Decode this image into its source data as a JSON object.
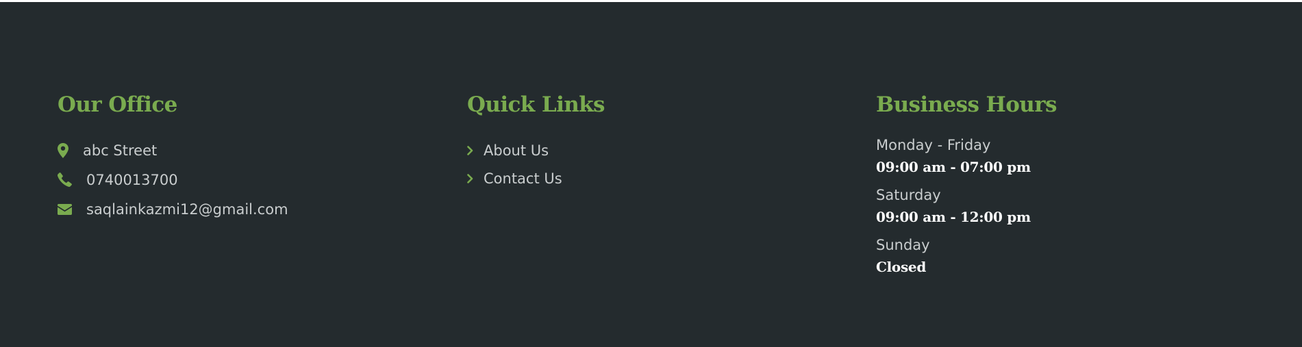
{
  "colors": {
    "background": "#242b2e",
    "accent": "#7aab4f",
    "text": "#c9cdce",
    "strong_text": "#ffffff"
  },
  "office": {
    "title": "Our Office",
    "address": {
      "icon": "map-marker-icon",
      "text": "abc Street"
    },
    "phone": {
      "icon": "phone-icon",
      "text": "0740013700"
    },
    "email": {
      "icon": "envelope-icon",
      "text": "saqlainkazmi12@gmail.com"
    }
  },
  "quick_links": {
    "title": "Quick Links",
    "icon": "chevron-right-icon",
    "items": [
      {
        "label": "About Us"
      },
      {
        "label": "Contact Us"
      }
    ]
  },
  "business_hours": {
    "title": "Business Hours",
    "entries": [
      {
        "day": "Monday - Friday",
        "time": "09:00 am - 07:00 pm"
      },
      {
        "day": "Saturday",
        "time": "09:00 am - 12:00 pm"
      },
      {
        "day": "Sunday",
        "time": "Closed"
      }
    ]
  }
}
